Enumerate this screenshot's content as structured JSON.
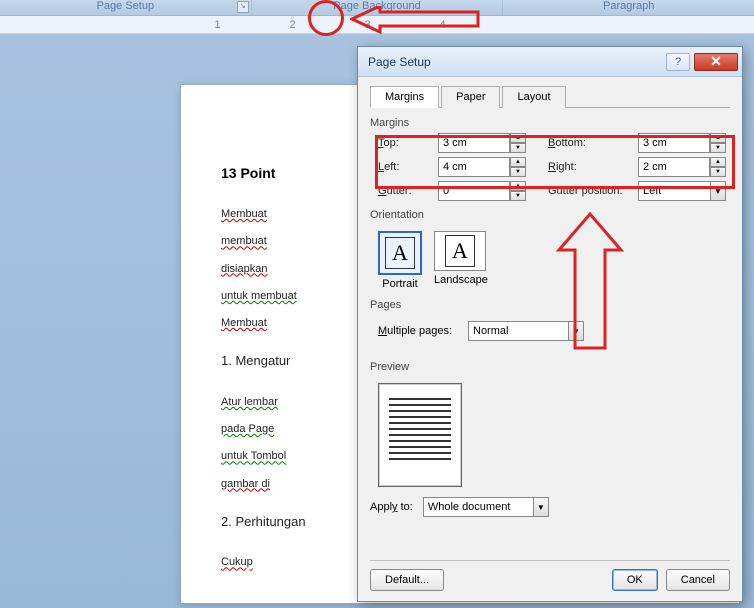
{
  "ribbon": {
    "group1": "Page Setup",
    "group2": "Page Background",
    "group3": "Paragraph"
  },
  "ruler": {
    "marks": [
      "1",
      "2",
      "3",
      "4"
    ]
  },
  "document": {
    "heading": "13 Point",
    "para1a": "Membuat",
    "para1b": "membuat",
    "para1c": "disiapkan",
    "para1d": "untuk membuat",
    "para1e": "Membuat",
    "item1": "1.  Mengatur",
    "para2a": "Atur lembar",
    "para2b": "pada Page",
    "para2c": "untuk Tombol",
    "para2d": "gambar di",
    "item2": "2.  Perhitungan",
    "para3": "Cukup"
  },
  "dialog": {
    "title": "Page Setup",
    "tabs": {
      "margins": "Margins",
      "paper": "Paper",
      "layout": "Layout"
    },
    "margins": {
      "group": "Margins",
      "top_label": "Top:",
      "top_value": "3 cm",
      "bottom_label": "Bottom:",
      "bottom_value": "3 cm",
      "left_label": "Left:",
      "left_value": "4 cm",
      "right_label": "Right:",
      "right_value": "2 cm",
      "gutter_label": "Gutter:",
      "gutter_value": "0\"",
      "gutterpos_label": "Gutter position:",
      "gutterpos_value": "Left"
    },
    "orientation": {
      "group": "Orientation",
      "portrait": "Portrait",
      "landscape": "Landscape"
    },
    "pages": {
      "group": "Pages",
      "label": "Multiple pages:",
      "value": "Normal"
    },
    "preview": {
      "group": "Preview"
    },
    "apply": {
      "label": "Apply to:",
      "value": "Whole document"
    },
    "buttons": {
      "default": "Default...",
      "ok": "OK",
      "cancel": "Cancel"
    }
  }
}
